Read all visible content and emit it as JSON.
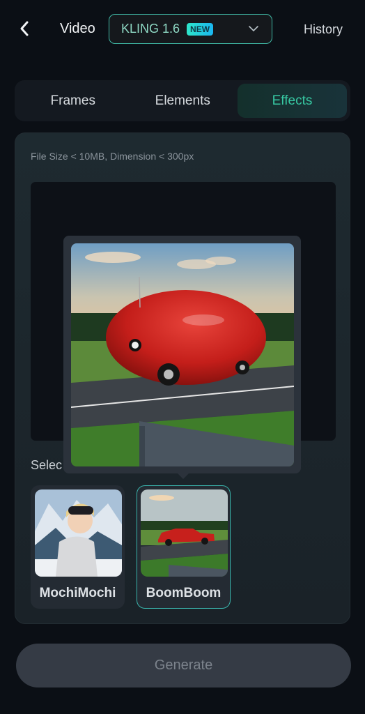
{
  "header": {
    "back_icon": "chevron-left-icon",
    "title": "Video",
    "model": {
      "name": "KLING 1.6",
      "badge": "NEW",
      "dropdown_icon": "chevron-down-icon"
    },
    "history_label": "History"
  },
  "tabs": [
    {
      "label": "Frames",
      "active": false
    },
    {
      "label": "Elements",
      "active": false
    },
    {
      "label": "Effects",
      "active": true
    }
  ],
  "panel": {
    "hint": "File Size < 10MB, Dimension < 300px",
    "select_label": "Selec",
    "preview": {
      "description": "Inflated red balloon-shaped car on a road at sunset"
    },
    "effects": [
      {
        "label": "MochiMochi",
        "selected": false,
        "thumb": "Person with ski goggles in front of snowy mountains"
      },
      {
        "label": "BoomBoom",
        "selected": true,
        "thumb": "Red classic sedan on road at sunset"
      }
    ]
  },
  "generate_label": "Generate",
  "colors": {
    "accent": "#37c9a3",
    "selected_border": "#3ab5ad",
    "background": "#0b0f15"
  }
}
